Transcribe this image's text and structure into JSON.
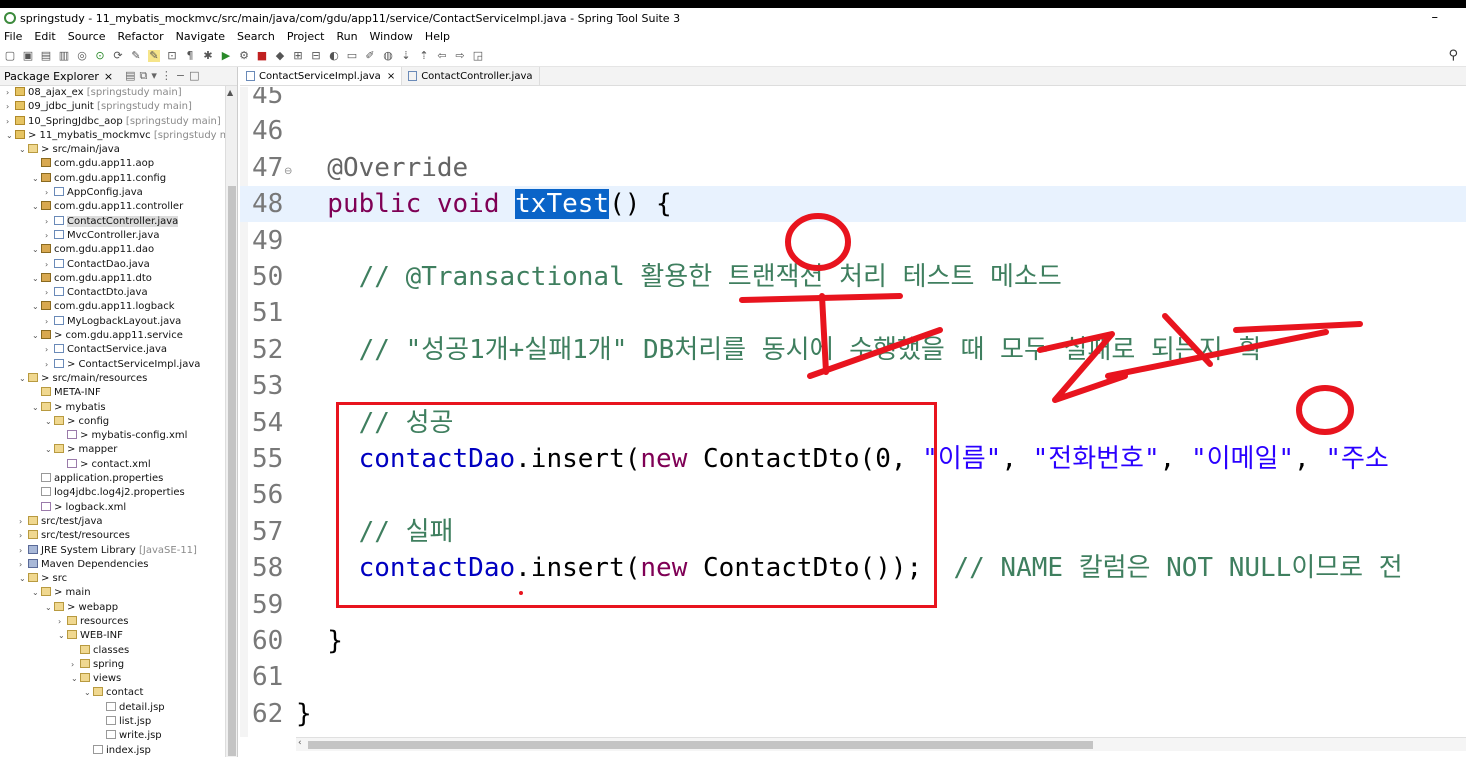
{
  "window": {
    "title": "springstudy - 11_mybatis_mockmvc/src/main/java/com/gdu/app11/service/ContactServiceImpl.java - Spring Tool Suite 3",
    "minimize": "–"
  },
  "menu": [
    "File",
    "Edit",
    "Source",
    "Refactor",
    "Navigate",
    "Search",
    "Project",
    "Run",
    "Window",
    "Help"
  ],
  "explorer": {
    "tab_label": "Package Explorer",
    "rows": [
      {
        "depth": 0,
        "tw": ">",
        "icon": "proj",
        "label": "08_ajax_ex",
        "muted": "[springstudy main]"
      },
      {
        "depth": 0,
        "tw": ">",
        "icon": "proj",
        "label": "09_jdbc_junit",
        "muted": "[springstudy main]"
      },
      {
        "depth": 0,
        "tw": ">",
        "icon": "proj",
        "label": "10_SpringJdbc_aop",
        "muted": "[springstudy main]"
      },
      {
        "depth": 0,
        "tw": "v",
        "icon": "proj",
        "label": "> 11_mybatis_mockmvc",
        "muted": "[springstudy main]"
      },
      {
        "depth": 1,
        "tw": "v",
        "icon": "folder",
        "label": "> src/main/java",
        "muted": ""
      },
      {
        "depth": 2,
        "tw": "",
        "icon": "pkg",
        "label": "com.gdu.app11.aop",
        "muted": ""
      },
      {
        "depth": 2,
        "tw": "v",
        "icon": "pkg",
        "label": "com.gdu.app11.config",
        "muted": ""
      },
      {
        "depth": 3,
        "tw": ">",
        "icon": "java",
        "label": "AppConfig.java",
        "muted": ""
      },
      {
        "depth": 2,
        "tw": "v",
        "icon": "pkg",
        "label": "com.gdu.app11.controller",
        "muted": ""
      },
      {
        "depth": 3,
        "tw": ">",
        "icon": "java",
        "label": "ContactController.java",
        "muted": "",
        "selected": true
      },
      {
        "depth": 3,
        "tw": ">",
        "icon": "java",
        "label": "MvcController.java",
        "muted": ""
      },
      {
        "depth": 2,
        "tw": "v",
        "icon": "pkg",
        "label": "com.gdu.app11.dao",
        "muted": ""
      },
      {
        "depth": 3,
        "tw": ">",
        "icon": "java",
        "label": "ContactDao.java",
        "muted": ""
      },
      {
        "depth": 2,
        "tw": "v",
        "icon": "pkg",
        "label": "com.gdu.app11.dto",
        "muted": ""
      },
      {
        "depth": 3,
        "tw": ">",
        "icon": "java",
        "label": "ContactDto.java",
        "muted": ""
      },
      {
        "depth": 2,
        "tw": "v",
        "icon": "pkg",
        "label": "com.gdu.app11.logback",
        "muted": ""
      },
      {
        "depth": 3,
        "tw": ">",
        "icon": "java",
        "label": "MyLogbackLayout.java",
        "muted": ""
      },
      {
        "depth": 2,
        "tw": "v",
        "icon": "pkg",
        "label": "> com.gdu.app11.service",
        "muted": ""
      },
      {
        "depth": 3,
        "tw": ">",
        "icon": "java",
        "label": "ContactService.java",
        "muted": ""
      },
      {
        "depth": 3,
        "tw": ">",
        "icon": "java",
        "label": "> ContactServiceImpl.java",
        "muted": ""
      },
      {
        "depth": 1,
        "tw": "v",
        "icon": "folder",
        "label": "> src/main/resources",
        "muted": ""
      },
      {
        "depth": 2,
        "tw": "",
        "icon": "folder",
        "label": "META-INF",
        "muted": ""
      },
      {
        "depth": 2,
        "tw": "v",
        "icon": "folder",
        "label": "> mybatis",
        "muted": ""
      },
      {
        "depth": 3,
        "tw": "v",
        "icon": "folder",
        "label": "> config",
        "muted": ""
      },
      {
        "depth": 4,
        "tw": "",
        "icon": "xml",
        "label": "> mybatis-config.xml",
        "muted": ""
      },
      {
        "depth": 3,
        "tw": "v",
        "icon": "folder",
        "label": "> mapper",
        "muted": ""
      },
      {
        "depth": 4,
        "tw": "",
        "icon": "xml",
        "label": "> contact.xml",
        "muted": ""
      },
      {
        "depth": 2,
        "tw": "",
        "icon": "file",
        "label": "application.properties",
        "muted": ""
      },
      {
        "depth": 2,
        "tw": "",
        "icon": "file",
        "label": "log4jdbc.log4j2.properties",
        "muted": ""
      },
      {
        "depth": 2,
        "tw": "",
        "icon": "xml",
        "label": "> logback.xml",
        "muted": ""
      },
      {
        "depth": 1,
        "tw": ">",
        "icon": "folder",
        "label": "src/test/java",
        "muted": ""
      },
      {
        "depth": 1,
        "tw": ">",
        "icon": "folder",
        "label": "src/test/resources",
        "muted": ""
      },
      {
        "depth": 1,
        "tw": ">",
        "icon": "lib",
        "label": "JRE System Library",
        "muted": "[JavaSE-11]"
      },
      {
        "depth": 1,
        "tw": ">",
        "icon": "lib",
        "label": "Maven Dependencies",
        "muted": ""
      },
      {
        "depth": 1,
        "tw": "v",
        "icon": "folder",
        "label": "> src",
        "muted": ""
      },
      {
        "depth": 2,
        "tw": "v",
        "icon": "folder",
        "label": "> main",
        "muted": ""
      },
      {
        "depth": 3,
        "tw": "v",
        "icon": "folder",
        "label": "> webapp",
        "muted": ""
      },
      {
        "depth": 4,
        "tw": ">",
        "icon": "folder",
        "label": "resources",
        "muted": ""
      },
      {
        "depth": 4,
        "tw": "v",
        "icon": "folder",
        "label": "WEB-INF",
        "muted": ""
      },
      {
        "depth": 5,
        "tw": "",
        "icon": "folder",
        "label": "classes",
        "muted": ""
      },
      {
        "depth": 5,
        "tw": ">",
        "icon": "folder",
        "label": "spring",
        "muted": ""
      },
      {
        "depth": 5,
        "tw": "v",
        "icon": "folder",
        "label": "views",
        "muted": ""
      },
      {
        "depth": 6,
        "tw": "v",
        "icon": "folder",
        "label": "contact",
        "muted": ""
      },
      {
        "depth": 7,
        "tw": "",
        "icon": "file",
        "label": "detail.jsp",
        "muted": ""
      },
      {
        "depth": 7,
        "tw": "",
        "icon": "file",
        "label": "list.jsp",
        "muted": ""
      },
      {
        "depth": 7,
        "tw": "",
        "icon": "file",
        "label": "write.jsp",
        "muted": ""
      },
      {
        "depth": 6,
        "tw": "",
        "icon": "file",
        "label": "index.jsp",
        "muted": ""
      }
    ]
  },
  "editor": {
    "tabs": [
      {
        "label": "ContactServiceImpl.java",
        "active": true,
        "closable": true
      },
      {
        "label": "ContactController.java",
        "active": false,
        "closable": false
      }
    ],
    "lines": [
      {
        "n": "45",
        "tokens": []
      },
      {
        "n": "46",
        "tokens": []
      },
      {
        "n": "47",
        "fold": true,
        "tokens": [
          [
            "ann",
            "  @Override"
          ]
        ]
      },
      {
        "n": "48",
        "hl": true,
        "tokens": [
          [
            "kw",
            "  public void "
          ],
          [
            "sel",
            "txTest"
          ],
          [
            "",
            "() {"
          ]
        ]
      },
      {
        "n": "49",
        "tokens": []
      },
      {
        "n": "50",
        "tokens": [
          [
            "cm",
            "    // @Transactional 활용한 트랜잭션 처리 테스트 메소드"
          ]
        ]
      },
      {
        "n": "51",
        "tokens": []
      },
      {
        "n": "52",
        "tokens": [
          [
            "cm",
            "    // \"성공1개+실패1개\" DB처리를 동시에 수행했을 때 모두 실패로 되는지 확"
          ]
        ]
      },
      {
        "n": "53",
        "tokens": []
      },
      {
        "n": "54",
        "tokens": [
          [
            "cm",
            "    // 성공"
          ]
        ]
      },
      {
        "n": "55",
        "tokens": [
          [
            "fld",
            "    contactDao"
          ],
          [
            "",
            ".insert("
          ],
          [
            "kw",
            "new"
          ],
          [
            "",
            " ContactDto(0, "
          ],
          [
            "str",
            "\"이름\""
          ],
          [
            "",
            ", "
          ],
          [
            "str",
            "\"전화번호\""
          ],
          [
            "",
            ", "
          ],
          [
            "str",
            "\"이메일\""
          ],
          [
            "",
            ", "
          ],
          [
            "str",
            "\"주소"
          ]
        ]
      },
      {
        "n": "56",
        "tokens": []
      },
      {
        "n": "57",
        "tokens": [
          [
            "cm",
            "    // 실패"
          ]
        ]
      },
      {
        "n": "58",
        "tokens": [
          [
            "fld",
            "    contactDao"
          ],
          [
            "",
            ".insert("
          ],
          [
            "kw",
            "new"
          ],
          [
            "",
            " ContactDto());  "
          ],
          [
            "cm",
            "// NAME 칼럼은 NOT NULL이므로 전"
          ]
        ]
      },
      {
        "n": "59",
        "tokens": []
      },
      {
        "n": "60",
        "tokens": [
          [
            "",
            "  }"
          ]
        ]
      },
      {
        "n": "61",
        "tokens": []
      },
      {
        "n": "62",
        "tokens": [
          [
            "",
            "}"
          ]
        ]
      }
    ]
  },
  "colors": {
    "keyword": "#7f0055",
    "comment": "#3f7f5f",
    "string": "#2a00ff",
    "field": "#0000c0",
    "annotation": "#646464",
    "highlight": "#e8f2fe",
    "selection": "#0a64c8",
    "red_ink": "#e8141e"
  },
  "icons": {
    "search": "search-icon",
    "close": "close-icon"
  }
}
